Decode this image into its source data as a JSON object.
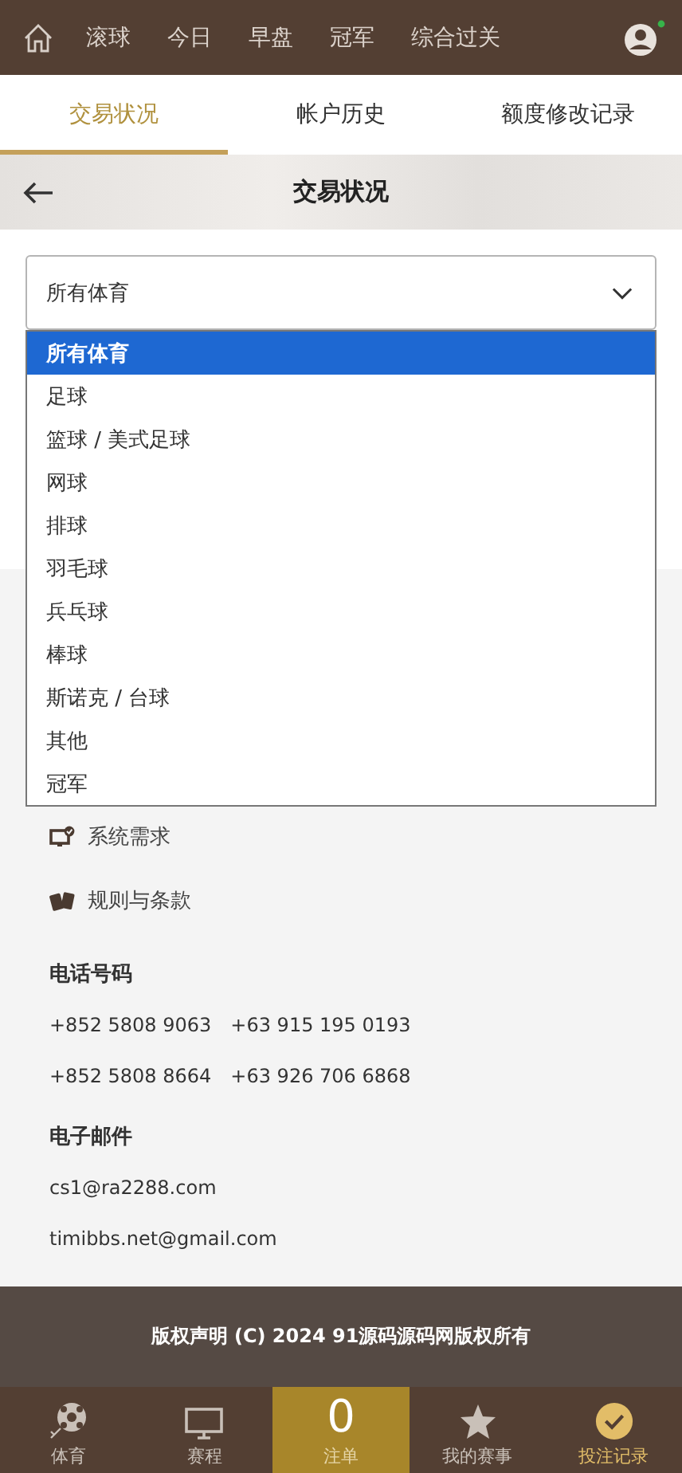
{
  "top_nav": {
    "items": [
      "滚球",
      "今日",
      "早盘",
      "冠军",
      "综合过关"
    ],
    "online": true
  },
  "tabs": [
    {
      "label": "交易状况",
      "selected": true
    },
    {
      "label": "帐户历史",
      "selected": false
    },
    {
      "label": "额度修改记录",
      "selected": false
    }
  ],
  "page_header": {
    "title": "交易状况"
  },
  "sport_select": {
    "value": "所有体育",
    "expanded": true,
    "options": [
      {
        "label": "所有体育",
        "selected": true
      },
      {
        "label": "足球",
        "selected": false
      },
      {
        "label": "篮球 / 美式足球",
        "selected": false
      },
      {
        "label": "网球",
        "selected": false
      },
      {
        "label": "排球",
        "selected": false
      },
      {
        "label": "羽毛球",
        "selected": false
      },
      {
        "label": "兵乓球",
        "selected": false
      },
      {
        "label": "棒球",
        "selected": false
      },
      {
        "label": "斯诺克 / 台球",
        "selected": false
      },
      {
        "label": "其他",
        "selected": false
      },
      {
        "label": "冠军",
        "selected": false
      }
    ]
  },
  "links": [
    {
      "label": "系统需求",
      "kind": "system"
    },
    {
      "label": "规则与条款",
      "kind": "rules"
    }
  ],
  "phone": {
    "heading": "电话号码",
    "rows": [
      [
        "+852 5808 9063",
        "+63 915 195 0193"
      ],
      [
        "+852 5808 8664",
        "+63 926 706 6868"
      ]
    ]
  },
  "email": {
    "heading": "电子邮件",
    "addresses": [
      "cs1@ra2288.com",
      "timibbs.net@gmail.com"
    ]
  },
  "footer": {
    "copyright": "版权声明 (C) 2024 91源码源码网版权所有"
  },
  "bottom_nav": [
    {
      "label": "体育",
      "kind": "sports",
      "selected": false
    },
    {
      "label": "赛程",
      "kind": "schedule",
      "selected": false
    },
    {
      "label": "注单",
      "kind": "slip",
      "count": "0",
      "selected": false
    },
    {
      "label": "我的赛事",
      "kind": "favorites",
      "selected": false
    },
    {
      "label": "投注记录",
      "kind": "history",
      "selected": true
    }
  ]
}
